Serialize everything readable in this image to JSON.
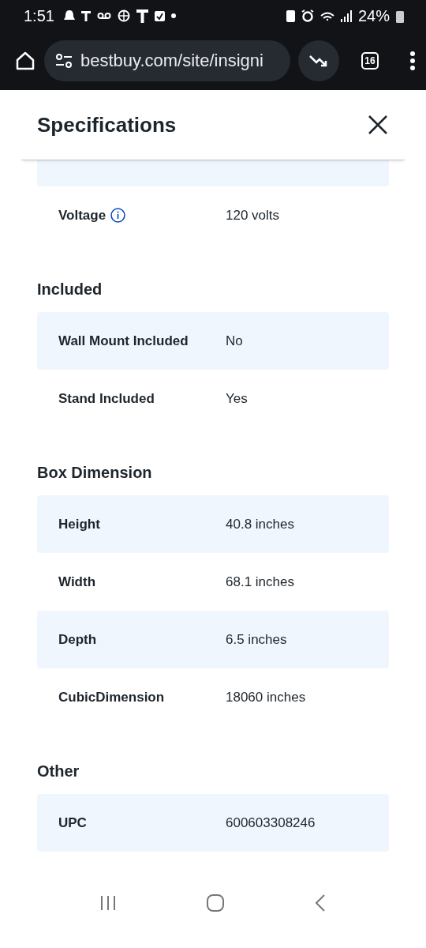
{
  "status_bar": {
    "time": "1:51",
    "battery": "24%"
  },
  "browser": {
    "url": "bestbuy.com/site/insigni",
    "tab_count": "16"
  },
  "panel": {
    "title": "Specifications"
  },
  "sections": [
    {
      "rows": [
        {
          "kind": "clipped"
        },
        {
          "kind": "spec",
          "label": "Voltage",
          "value": "120 volts",
          "has_info": true
        }
      ]
    },
    {
      "heading": "Included",
      "rows": [
        {
          "kind": "spec",
          "label": "Wall Mount Included",
          "value": "No",
          "has_info": false
        },
        {
          "kind": "spec",
          "label": "Stand Included",
          "value": "Yes",
          "has_info": false
        }
      ]
    },
    {
      "heading": "Box Dimension",
      "rows": [
        {
          "kind": "spec",
          "label": "Height",
          "value": "40.8 inches",
          "has_info": false
        },
        {
          "kind": "spec",
          "label": "Width",
          "value": "68.1 inches",
          "has_info": false
        },
        {
          "kind": "spec",
          "label": "Depth",
          "value": "6.5 inches",
          "has_info": false
        },
        {
          "kind": "spec",
          "label": "CubicDimension",
          "value": "18060 inches",
          "has_info": false
        }
      ]
    },
    {
      "heading": "Other",
      "rows": [
        {
          "kind": "spec",
          "label": "UPC",
          "value": "600603308246",
          "has_info": false
        }
      ]
    }
  ]
}
